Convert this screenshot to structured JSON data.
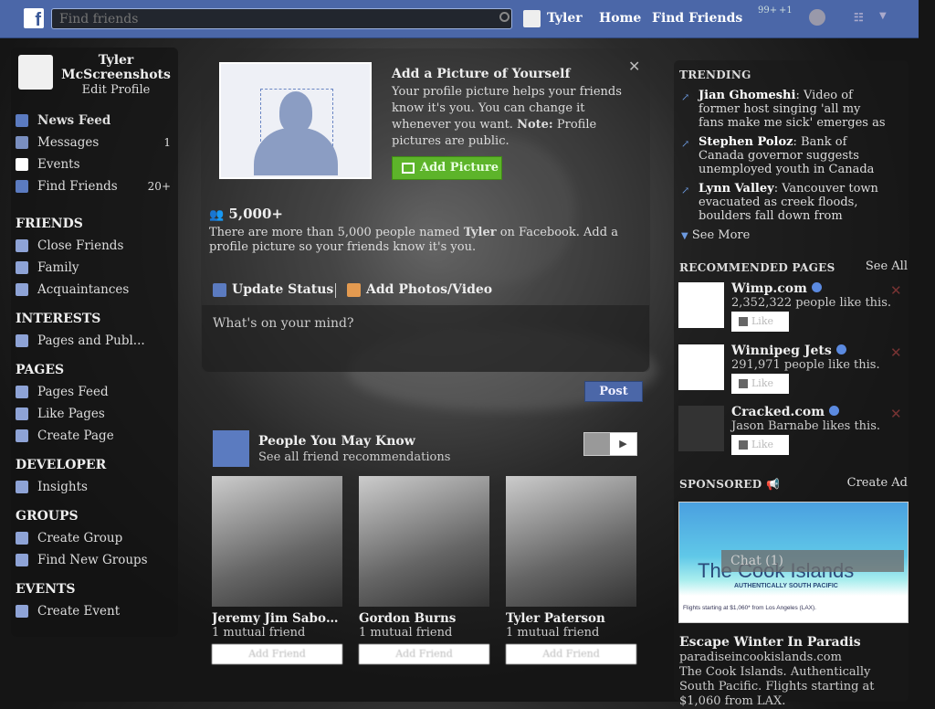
{
  "topbar": {
    "search_placeholder": "Find friends",
    "user": "Tyler",
    "home": "Home",
    "find_friends": "Find Friends",
    "notif_requests": "99+",
    "notif_messages": "+1"
  },
  "sidebar": {
    "name": "Tyler McScreenshots",
    "edit_profile": "Edit Profile",
    "main": [
      {
        "label": "News Feed",
        "icon": "news-feed-icon",
        "count": ""
      },
      {
        "label": "Messages",
        "icon": "messages-icon",
        "count": "1"
      },
      {
        "label": "Events",
        "icon": "calendar-icon",
        "count": ""
      },
      {
        "label": "Find Friends",
        "icon": "find-friends-icon",
        "count": "20+"
      }
    ],
    "sections": [
      {
        "title": "FRIENDS",
        "items": [
          "Close Friends",
          "Family",
          "Acquaintances"
        ]
      },
      {
        "title": "INTERESTS",
        "items": [
          "Pages and Publ..."
        ]
      },
      {
        "title": "PAGES",
        "items": [
          "Pages Feed",
          "Like Pages",
          "Create Page"
        ]
      },
      {
        "title": "DEVELOPER",
        "items": [
          "Insights"
        ]
      },
      {
        "title": "GROUPS",
        "items": [
          "Create Group",
          "Find New Groups"
        ]
      },
      {
        "title": "EVENTS",
        "items": [
          "Create Event"
        ]
      }
    ]
  },
  "profile_prompt": {
    "title": "Add a Picture of Yourself",
    "text": "Your profile picture helps your friends know it's you. You can change it whenever you want.",
    "note_label": "Note:",
    "note_text": "Profile pictures are public.",
    "button": "Add Picture",
    "count": "5,000+",
    "count_text_1": "There are more than 5,000 people named",
    "count_name": "Tyler",
    "count_text_2": "on Facebook. Add a profile picture so your friends know it's you."
  },
  "composer": {
    "tab_status": "Update Status",
    "tab_photos": "Add Photos/Video",
    "placeholder": "What's on your mind?",
    "post": "Post"
  },
  "pymk": {
    "title": "People You May Know",
    "subtitle": "See all friend recommendations",
    "people": [
      {
        "name": "Jeremy Jim Sabou...",
        "mutual": "1 mutual friend",
        "button": "Add Friend"
      },
      {
        "name": "Gordon Burns",
        "mutual": "1 mutual friend",
        "button": "Add Friend"
      },
      {
        "name": "Tyler Paterson",
        "mutual": "1 mutual friend",
        "button": "Add Friend"
      }
    ]
  },
  "trending": {
    "title": "TRENDING",
    "items": [
      {
        "topic": "Jian Ghomeshi",
        "text": ": Video of former host singing 'all my fans make me sick' emerges as"
      },
      {
        "topic": "Stephen Poloz",
        "text": ": Bank of Canada governor suggests unemployed youth in Canada"
      },
      {
        "topic": "Lynn Valley",
        "text": ": Vancouver town evacuated as creek floods, boulders fall down from"
      }
    ],
    "see_more": "See More"
  },
  "recommended": {
    "title": "RECOMMENDED PAGES",
    "see_all": "See All",
    "pages": [
      {
        "name": "Wimp.com",
        "likes": "2,352,322 people like this.",
        "logo": "wimp",
        "button": "Like"
      },
      {
        "name": "Winnipeg Jets",
        "likes": "291,971 people like this.",
        "logo": "jets",
        "button": "Like"
      },
      {
        "name": "Cracked.com",
        "likes": "Jason Barnabe likes this.",
        "logo": "C",
        "button": "Like"
      }
    ]
  },
  "sponsored": {
    "title": "SPONSORED",
    "create_ad": "Create Ad",
    "ad_banner": "The Cook Islands",
    "ad_banner_sub": "AUTHENTICALLY SOUTH PACIFIC",
    "ad_banner_footer": "Flights starting at $1,060* from Los Angeles (LAX).",
    "ad_title": "Escape Winter In Paradis",
    "ad_domain": "paradiseincookislands.com",
    "ad_text": "The Cook Islands. Authentically South Pacific. Flights starting at $1,060 from LAX."
  },
  "chat": {
    "label": "Chat (1)"
  }
}
